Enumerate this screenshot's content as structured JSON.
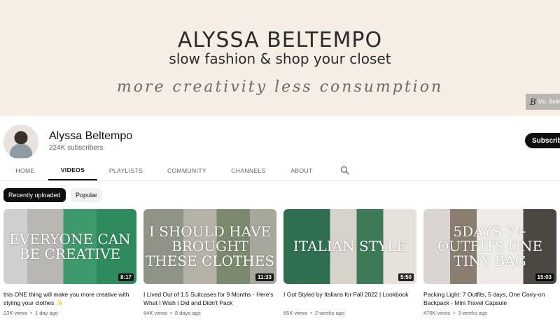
{
  "banner": {
    "title": "ALYSSA BELTEMPO",
    "subtitle": "slow fashion & shop your closet",
    "script": "more creativity less consumption",
    "badge_logo": "B",
    "badge_text": "Ms. Belte"
  },
  "channel": {
    "name": "Alyssa Beltempo",
    "subscribers": "224K subscribers",
    "subscribe_label": "Subscribe"
  },
  "tabs": [
    {
      "label": "HOME"
    },
    {
      "label": "VIDEOS",
      "active": true
    },
    {
      "label": "PLAYLISTS"
    },
    {
      "label": "COMMUNITY"
    },
    {
      "label": "CHANNELS"
    },
    {
      "label": "ABOUT"
    }
  ],
  "search_icon": "search-icon",
  "chips": [
    {
      "label": "Recently uploaded",
      "active": true
    },
    {
      "label": "Popular",
      "active": false
    }
  ],
  "videos": [
    {
      "thumb_text": "EVERYONE CAN BE CREATIVE",
      "duration": "8:17",
      "title": "this ONE thing will make you more creative with styling your clothes ✨",
      "views": "23K views",
      "age": "1 day ago"
    },
    {
      "thumb_text": "I SHOULD HAVE BROUGHT THESE CLOTHES",
      "duration": "11:33",
      "title": "I Lived Out of 1.5 Suitcases for 9 Months - Here's What I Wish I Did and Didn't Pack",
      "views": "64K views",
      "age": "8 days ago"
    },
    {
      "thumb_text": "ITALIAN STYLE",
      "duration": "5:50",
      "title": "I Got Styled by Italians for Fall 2022 | Lookbook",
      "views": "65K views",
      "age": "2 weeks ago"
    },
    {
      "thumb_text": "5DAYS 7+ OUTFITS ONE TINY BAG",
      "duration": "15:03",
      "title": "Packing Light: 7 Outfits, 5 days, One Carry-on Backpack - Mini Travel Capsule",
      "views": "470K views",
      "age": "3 weeks ago"
    }
  ],
  "meta_separator": "•",
  "colors": {
    "banner_bg": "#f6ede4",
    "subscribe_bg": "#0f0f0f",
    "chip_active_bg": "#0f0f0f",
    "chip_inactive_bg": "#f2f2f2",
    "secondary_text": "#606060"
  }
}
